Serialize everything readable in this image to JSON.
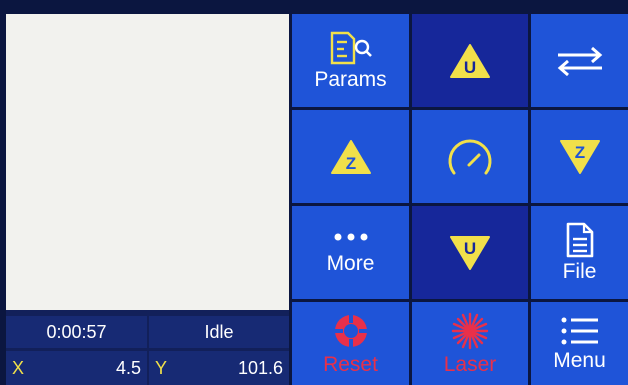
{
  "status": {
    "time": "0:00:57",
    "state": "Idle",
    "x_label": "X",
    "x_value": "4.5",
    "y_label": "Y",
    "y_value": "101.6"
  },
  "buttons": {
    "params": "Params",
    "more": "More",
    "file": "File",
    "reset": "Reset",
    "laser": "Laser",
    "menu": "Menu",
    "u_up": "U",
    "z_up": "Z",
    "z_down": "Z",
    "u_down": "U"
  },
  "icons": {
    "params": "params-icon",
    "u_up": "u-up-triangle-icon",
    "swap": "swap-arrows-icon",
    "z_up": "z-up-triangle-icon",
    "speed": "speedometer-icon",
    "z_down": "z-down-triangle-icon",
    "more": "more-dots-icon",
    "u_down": "u-down-triangle-icon",
    "file": "file-icon",
    "reset": "reset-icon",
    "laser": "laser-burst-icon",
    "menu": "menu-list-icon"
  },
  "colors": {
    "button_blue": "#1f54d8",
    "button_dark": "#16279a",
    "yellow": "#f1e04a",
    "red": "#e8304a"
  }
}
